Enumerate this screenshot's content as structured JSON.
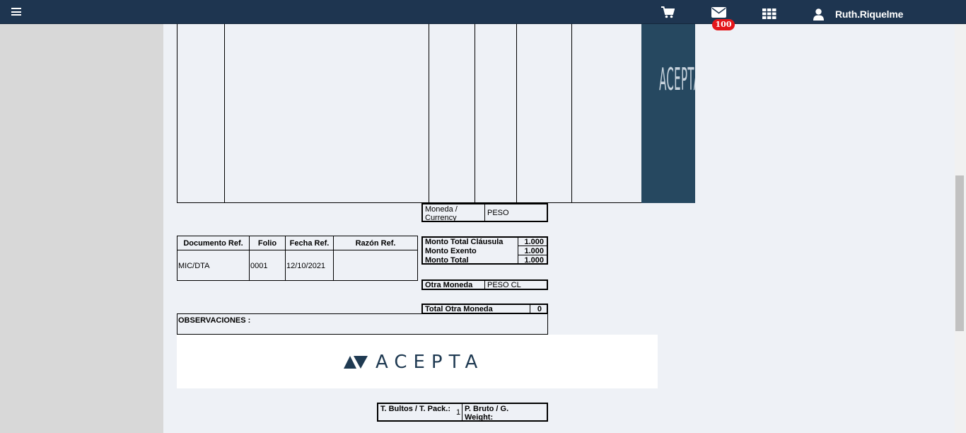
{
  "header": {
    "menu_icon": "hamburger-menu-icon",
    "cart_icon": "shopping-cart-icon",
    "mail_icon": "envelope-icon",
    "mail_badge": "100",
    "apps_icon": "apps-grid-icon",
    "user_icon": "user-icon",
    "username": "Ruth.Riquelme",
    "colors": {
      "bar": "#1e3550",
      "badge": "#e4161a"
    }
  },
  "document": {
    "side_logo_text": "ACEPTA",
    "moneda": {
      "label": "Moneda / Currency",
      "value": "PESO"
    },
    "references": {
      "headers": [
        "Documento Ref.",
        "Folio",
        "Fecha Ref.",
        "Razón Ref."
      ],
      "rows": [
        [
          "MIC/DTA",
          "0001",
          "12/10/2021",
          ""
        ]
      ]
    },
    "totals": [
      {
        "label": "Monto Total Cláusula",
        "value": "1.000"
      },
      {
        "label": "Monto Exento",
        "value": "1.000"
      },
      {
        "label": "Monto Total",
        "value": "1.000"
      }
    ],
    "otra_moneda": {
      "label": "Otra Moneda",
      "value": "PESO CL"
    },
    "total_otra_moneda": {
      "label": "Total Otra Moneda",
      "value": "0"
    },
    "observaciones": {
      "label": "OBSERVACIONES :",
      "value": ""
    },
    "logo_text": "ACEPTA",
    "bultos": {
      "label": "T. Bultos / T. Pack.:",
      "value": "1"
    },
    "peso_bruto": {
      "label": "P. Bruto / G. Weight:",
      "value": ""
    }
  }
}
